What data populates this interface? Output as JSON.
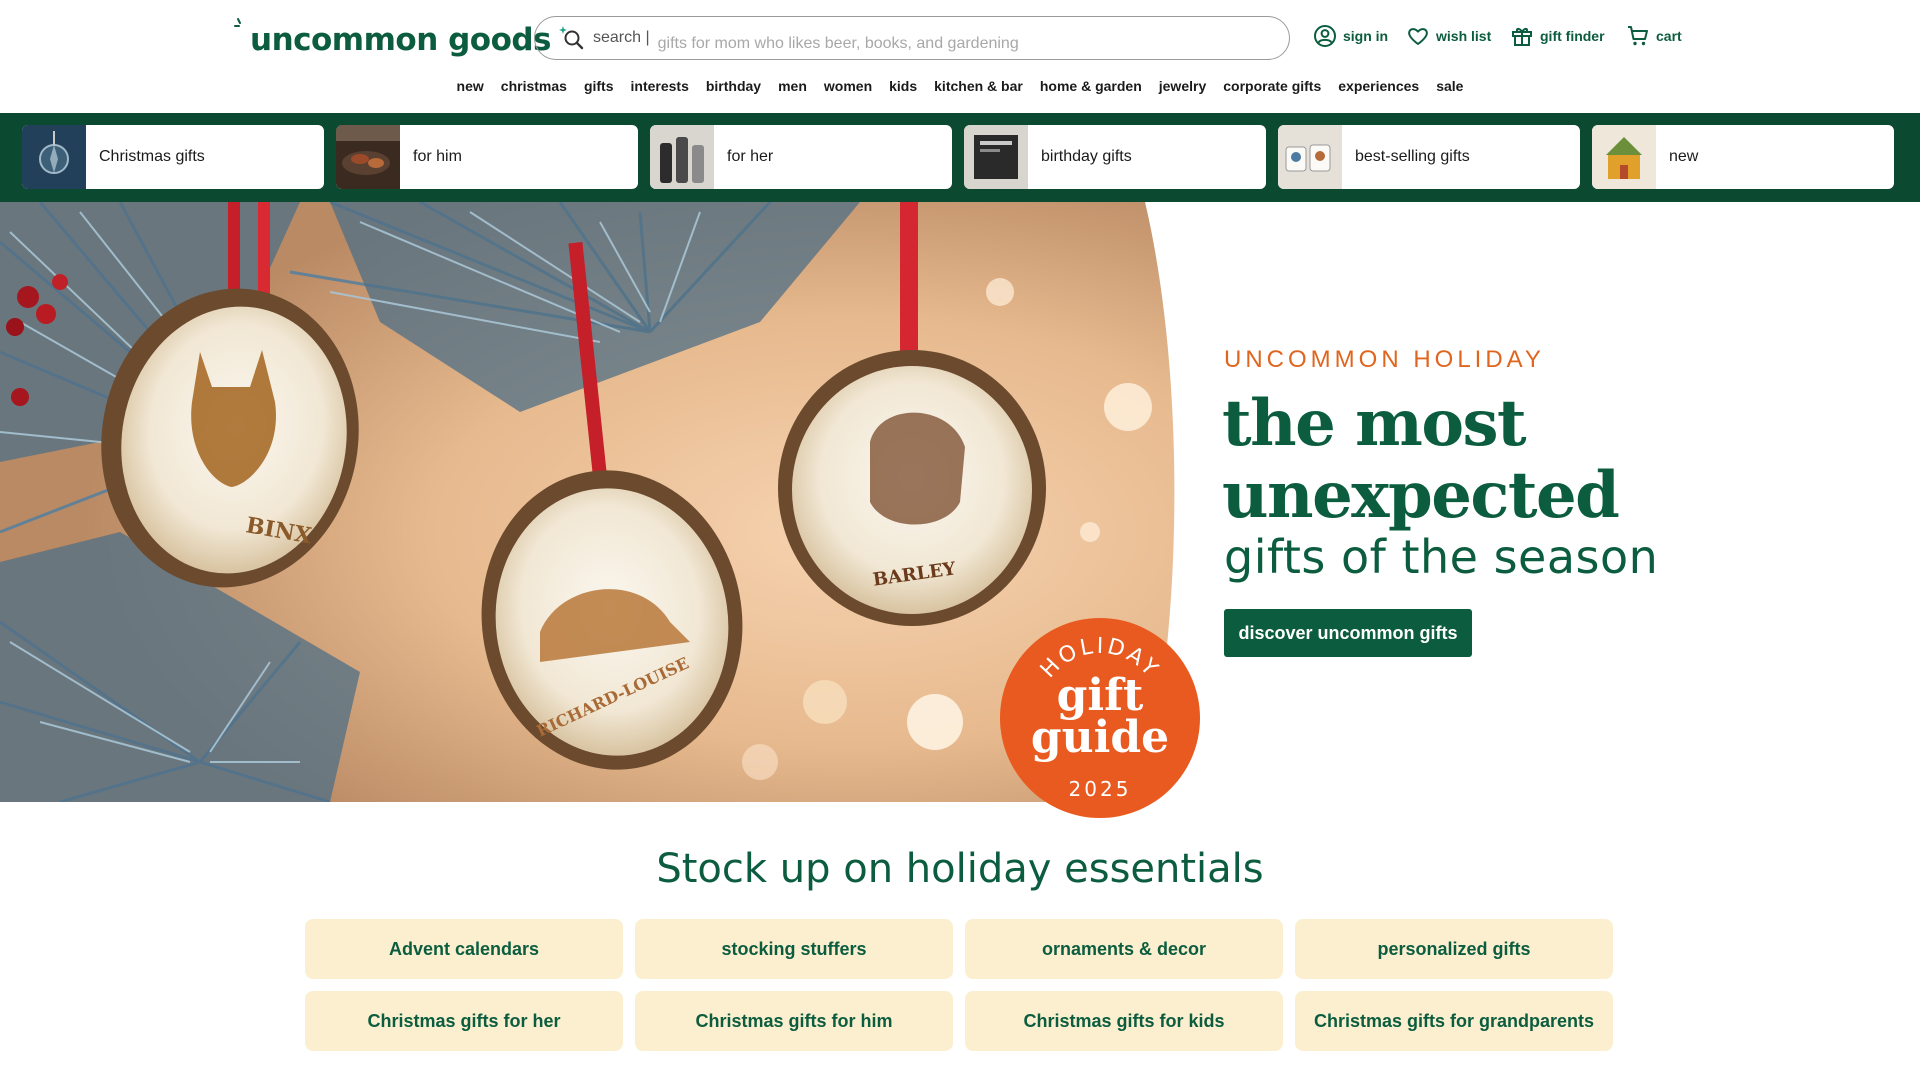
{
  "header": {
    "logo_text": "uncommon goods",
    "search": {
      "label": "search |",
      "placeholder": "gifts for mom who likes beer, books, and gardening"
    },
    "utility": [
      {
        "label": "sign in",
        "icon": "user-circle-icon"
      },
      {
        "label": "wish list",
        "icon": "heart-icon"
      },
      {
        "label": "gift finder",
        "icon": "gift-icon"
      },
      {
        "label": "cart",
        "icon": "cart-icon"
      }
    ],
    "nav": [
      "new",
      "christmas",
      "gifts",
      "interests",
      "birthday",
      "men",
      "women",
      "kids",
      "kitchen & bar",
      "home & garden",
      "jewelry",
      "corporate gifts",
      "experiences",
      "sale"
    ]
  },
  "categories": [
    {
      "label": "Christmas gifts"
    },
    {
      "label": "for him"
    },
    {
      "label": "for her"
    },
    {
      "label": "birthday gifts"
    },
    {
      "label": "best-selling gifts"
    },
    {
      "label": "new"
    }
  ],
  "hero": {
    "eyebrow": "UNCOMMON HOLIDAY",
    "headline_bold": "the most unexpected",
    "headline_light": "gifts of the season",
    "cta": "discover uncommon gifts",
    "ornaments": [
      "BINX",
      "RICHARD-LOUISE",
      "BARLEY"
    ],
    "badge": {
      "top": "HOLIDAY",
      "line1": "gift",
      "line2": "guide",
      "year": "2025"
    }
  },
  "essentials": {
    "title": "Stock up on holiday essentials",
    "buttons": [
      "Advent calendars",
      "stocking stuffers",
      "ornaments & decor",
      "personalized gifts",
      "Christmas gifts for her",
      "Christmas gifts for him",
      "Christmas gifts for kids",
      "Christmas gifts for grandparents"
    ]
  },
  "colors": {
    "brand_green": "#0c5d3f",
    "dark_green_bar": "#0b4a31",
    "accent_orange": "#e85a1f",
    "essentials_bg": "#fbefcf"
  }
}
